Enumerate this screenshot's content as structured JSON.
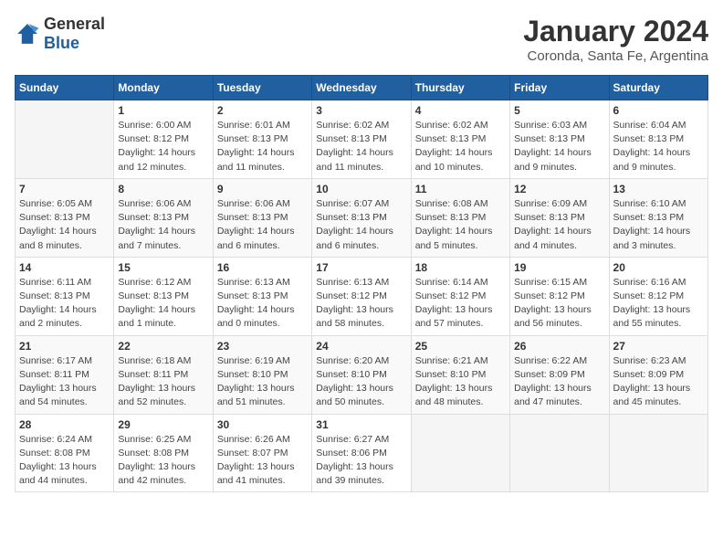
{
  "header": {
    "logo_general": "General",
    "logo_blue": "Blue",
    "month_year": "January 2024",
    "location": "Coronda, Santa Fe, Argentina"
  },
  "days_of_week": [
    "Sunday",
    "Monday",
    "Tuesday",
    "Wednesday",
    "Thursday",
    "Friday",
    "Saturday"
  ],
  "weeks": [
    [
      {
        "day": "",
        "info": ""
      },
      {
        "day": "1",
        "info": "Sunrise: 6:00 AM\nSunset: 8:12 PM\nDaylight: 14 hours\nand 12 minutes."
      },
      {
        "day": "2",
        "info": "Sunrise: 6:01 AM\nSunset: 8:13 PM\nDaylight: 14 hours\nand 11 minutes."
      },
      {
        "day": "3",
        "info": "Sunrise: 6:02 AM\nSunset: 8:13 PM\nDaylight: 14 hours\nand 11 minutes."
      },
      {
        "day": "4",
        "info": "Sunrise: 6:02 AM\nSunset: 8:13 PM\nDaylight: 14 hours\nand 10 minutes."
      },
      {
        "day": "5",
        "info": "Sunrise: 6:03 AM\nSunset: 8:13 PM\nDaylight: 14 hours\nand 9 minutes."
      },
      {
        "day": "6",
        "info": "Sunrise: 6:04 AM\nSunset: 8:13 PM\nDaylight: 14 hours\nand 9 minutes."
      }
    ],
    [
      {
        "day": "7",
        "info": "Sunrise: 6:05 AM\nSunset: 8:13 PM\nDaylight: 14 hours\nand 8 minutes."
      },
      {
        "day": "8",
        "info": "Sunrise: 6:06 AM\nSunset: 8:13 PM\nDaylight: 14 hours\nand 7 minutes."
      },
      {
        "day": "9",
        "info": "Sunrise: 6:06 AM\nSunset: 8:13 PM\nDaylight: 14 hours\nand 6 minutes."
      },
      {
        "day": "10",
        "info": "Sunrise: 6:07 AM\nSunset: 8:13 PM\nDaylight: 14 hours\nand 6 minutes."
      },
      {
        "day": "11",
        "info": "Sunrise: 6:08 AM\nSunset: 8:13 PM\nDaylight: 14 hours\nand 5 minutes."
      },
      {
        "day": "12",
        "info": "Sunrise: 6:09 AM\nSunset: 8:13 PM\nDaylight: 14 hours\nand 4 minutes."
      },
      {
        "day": "13",
        "info": "Sunrise: 6:10 AM\nSunset: 8:13 PM\nDaylight: 14 hours\nand 3 minutes."
      }
    ],
    [
      {
        "day": "14",
        "info": "Sunrise: 6:11 AM\nSunset: 8:13 PM\nDaylight: 14 hours\nand 2 minutes."
      },
      {
        "day": "15",
        "info": "Sunrise: 6:12 AM\nSunset: 8:13 PM\nDaylight: 14 hours\nand 1 minute."
      },
      {
        "day": "16",
        "info": "Sunrise: 6:13 AM\nSunset: 8:13 PM\nDaylight: 14 hours\nand 0 minutes."
      },
      {
        "day": "17",
        "info": "Sunrise: 6:13 AM\nSunset: 8:12 PM\nDaylight: 13 hours\nand 58 minutes."
      },
      {
        "day": "18",
        "info": "Sunrise: 6:14 AM\nSunset: 8:12 PM\nDaylight: 13 hours\nand 57 minutes."
      },
      {
        "day": "19",
        "info": "Sunrise: 6:15 AM\nSunset: 8:12 PM\nDaylight: 13 hours\nand 56 minutes."
      },
      {
        "day": "20",
        "info": "Sunrise: 6:16 AM\nSunset: 8:12 PM\nDaylight: 13 hours\nand 55 minutes."
      }
    ],
    [
      {
        "day": "21",
        "info": "Sunrise: 6:17 AM\nSunset: 8:11 PM\nDaylight: 13 hours\nand 54 minutes."
      },
      {
        "day": "22",
        "info": "Sunrise: 6:18 AM\nSunset: 8:11 PM\nDaylight: 13 hours\nand 52 minutes."
      },
      {
        "day": "23",
        "info": "Sunrise: 6:19 AM\nSunset: 8:10 PM\nDaylight: 13 hours\nand 51 minutes."
      },
      {
        "day": "24",
        "info": "Sunrise: 6:20 AM\nSunset: 8:10 PM\nDaylight: 13 hours\nand 50 minutes."
      },
      {
        "day": "25",
        "info": "Sunrise: 6:21 AM\nSunset: 8:10 PM\nDaylight: 13 hours\nand 48 minutes."
      },
      {
        "day": "26",
        "info": "Sunrise: 6:22 AM\nSunset: 8:09 PM\nDaylight: 13 hours\nand 47 minutes."
      },
      {
        "day": "27",
        "info": "Sunrise: 6:23 AM\nSunset: 8:09 PM\nDaylight: 13 hours\nand 45 minutes."
      }
    ],
    [
      {
        "day": "28",
        "info": "Sunrise: 6:24 AM\nSunset: 8:08 PM\nDaylight: 13 hours\nand 44 minutes."
      },
      {
        "day": "29",
        "info": "Sunrise: 6:25 AM\nSunset: 8:08 PM\nDaylight: 13 hours\nand 42 minutes."
      },
      {
        "day": "30",
        "info": "Sunrise: 6:26 AM\nSunset: 8:07 PM\nDaylight: 13 hours\nand 41 minutes."
      },
      {
        "day": "31",
        "info": "Sunrise: 6:27 AM\nSunset: 8:06 PM\nDaylight: 13 hours\nand 39 minutes."
      },
      {
        "day": "",
        "info": ""
      },
      {
        "day": "",
        "info": ""
      },
      {
        "day": "",
        "info": ""
      }
    ]
  ]
}
